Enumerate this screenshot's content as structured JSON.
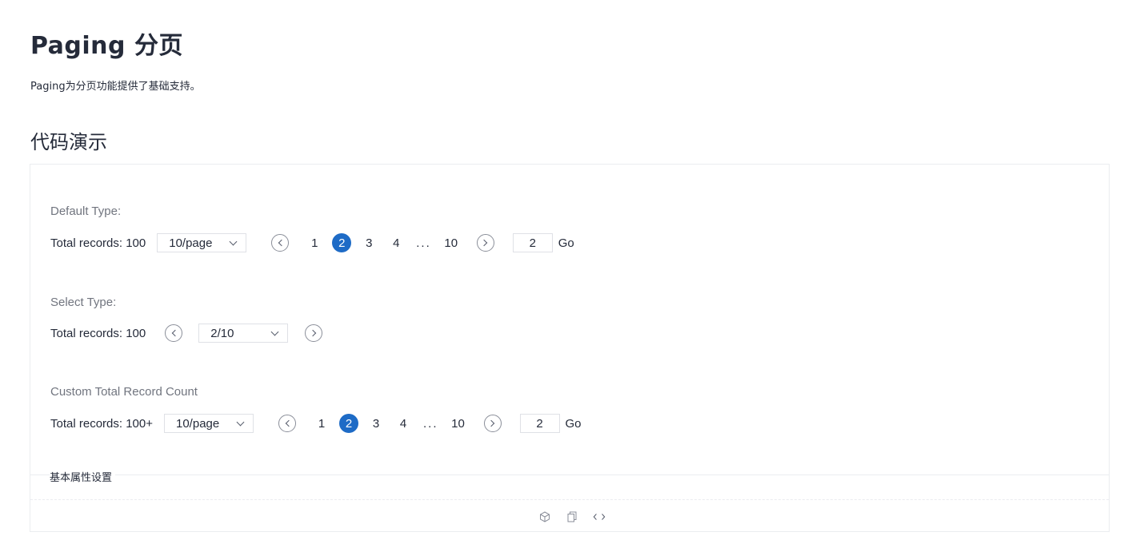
{
  "header": {
    "title": "Paging 分页",
    "description": "Paging为分页功能提供了基础支持。"
  },
  "section": {
    "title": "代码演示"
  },
  "demos": {
    "default": {
      "label": "Default Type:",
      "total": "Total records: 100",
      "page_size": "10/page",
      "pages": [
        "1",
        "2",
        "3",
        "4",
        "10"
      ],
      "active_page": "2",
      "ellipsis": "...",
      "jump_value": "2",
      "go_label": "Go"
    },
    "select": {
      "label": "Select Type:",
      "total": "Total records: 100",
      "current": "2/10"
    },
    "custom": {
      "label": "Custom Total Record Count",
      "total": "Total records: 100+",
      "page_size": "10/page",
      "pages": [
        "1",
        "2",
        "3",
        "4",
        "10"
      ],
      "active_page": "2",
      "ellipsis": "...",
      "jump_value": "2",
      "go_label": "Go"
    }
  },
  "footer": {
    "basic_props_label": "基本属性设置",
    "icons": [
      "codesandbox-icon",
      "copy-icon",
      "code-icon"
    ]
  },
  "colors": {
    "accent": "#1e6bc6",
    "text": "#252b3a",
    "muted": "#71757f",
    "border": "#dfe1e6"
  }
}
